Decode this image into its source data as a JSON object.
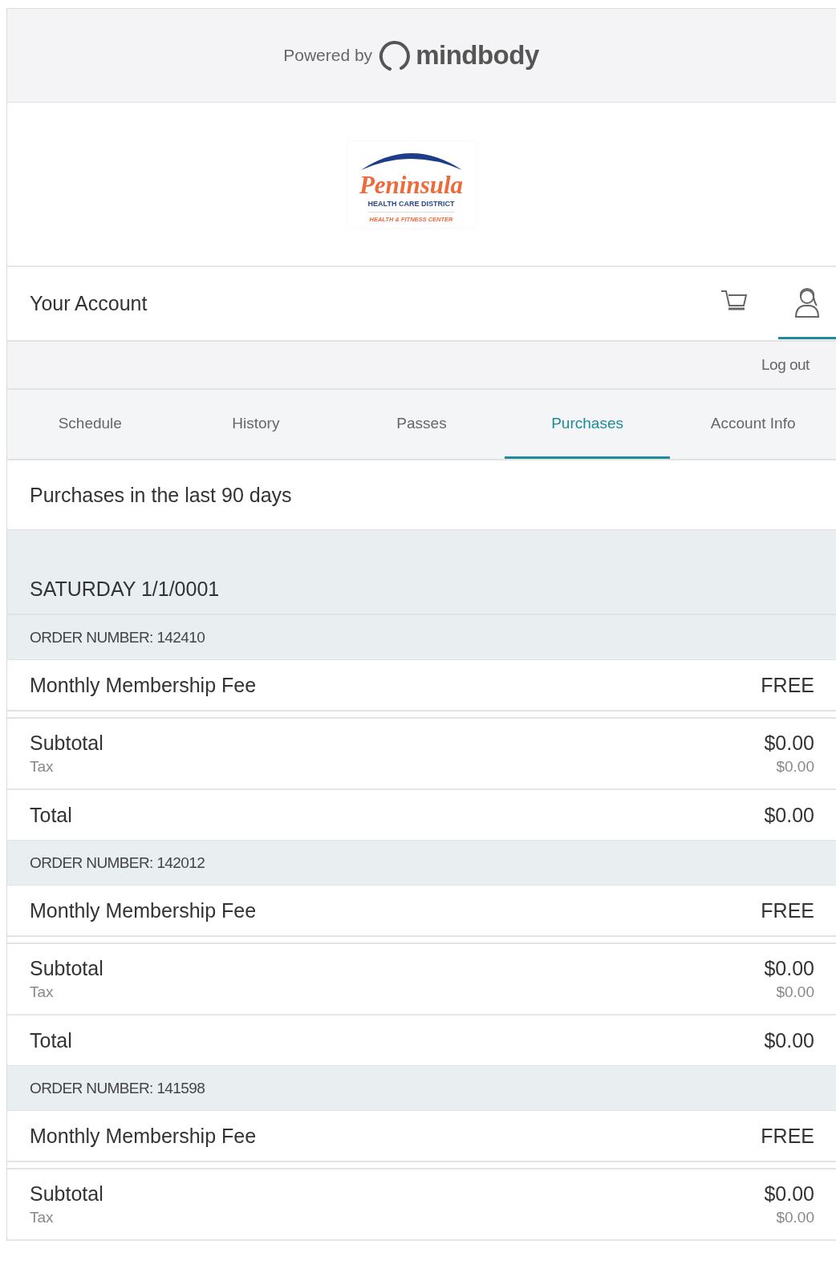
{
  "header": {
    "powered_by": "Powered by",
    "brand": "mindbody"
  },
  "logo": {
    "name": "Peninsula",
    "line_1": "HEALTH CARE DISTRICT",
    "line_2": "HEALTH & FITNESS CENTER"
  },
  "account_bar": {
    "title": "Your Account",
    "icons": [
      {
        "kind": "cart",
        "selected": false
      },
      {
        "kind": "person",
        "selected": true
      }
    ]
  },
  "logout": "Log out",
  "tabs": [
    {
      "label": "Schedule",
      "selected": false
    },
    {
      "label": "History",
      "selected": false
    },
    {
      "label": "Passes",
      "selected": false
    },
    {
      "label": "Purchases",
      "selected": true
    },
    {
      "label": "Account Info",
      "selected": false
    }
  ],
  "section_title": "Purchases in the last 90 days",
  "date": "SATURDAY 1/1/0001",
  "orders": [
    {
      "order_number": "ORDER NUMBER: 142410",
      "items": [
        {
          "name": "Monthly Membership Fee",
          "price": "FREE"
        }
      ],
      "subtotal": {
        "label": "Subtotal",
        "value": "$0.00"
      },
      "tax": {
        "label": "Tax",
        "value": "$0.00"
      },
      "total": {
        "label": "Total",
        "value": "$0.00"
      }
    },
    {
      "order_number": "ORDER NUMBER: 142012",
      "items": [
        {
          "name": "Monthly Membership Fee",
          "price": "FREE"
        }
      ],
      "subtotal": {
        "label": "Subtotal",
        "value": "$0.00"
      },
      "tax": {
        "label": "Tax",
        "value": "$0.00"
      },
      "total": {
        "label": "Total",
        "value": "$0.00"
      }
    },
    {
      "order_number": "ORDER NUMBER: 141598",
      "items": [
        {
          "name": "Monthly Membership Fee",
          "price": "FREE"
        }
      ],
      "subtotal": {
        "label": "Subtotal",
        "value": "$0.00"
      },
      "tax": {
        "label": "Tax",
        "value": "$0.00"
      }
    }
  ]
}
